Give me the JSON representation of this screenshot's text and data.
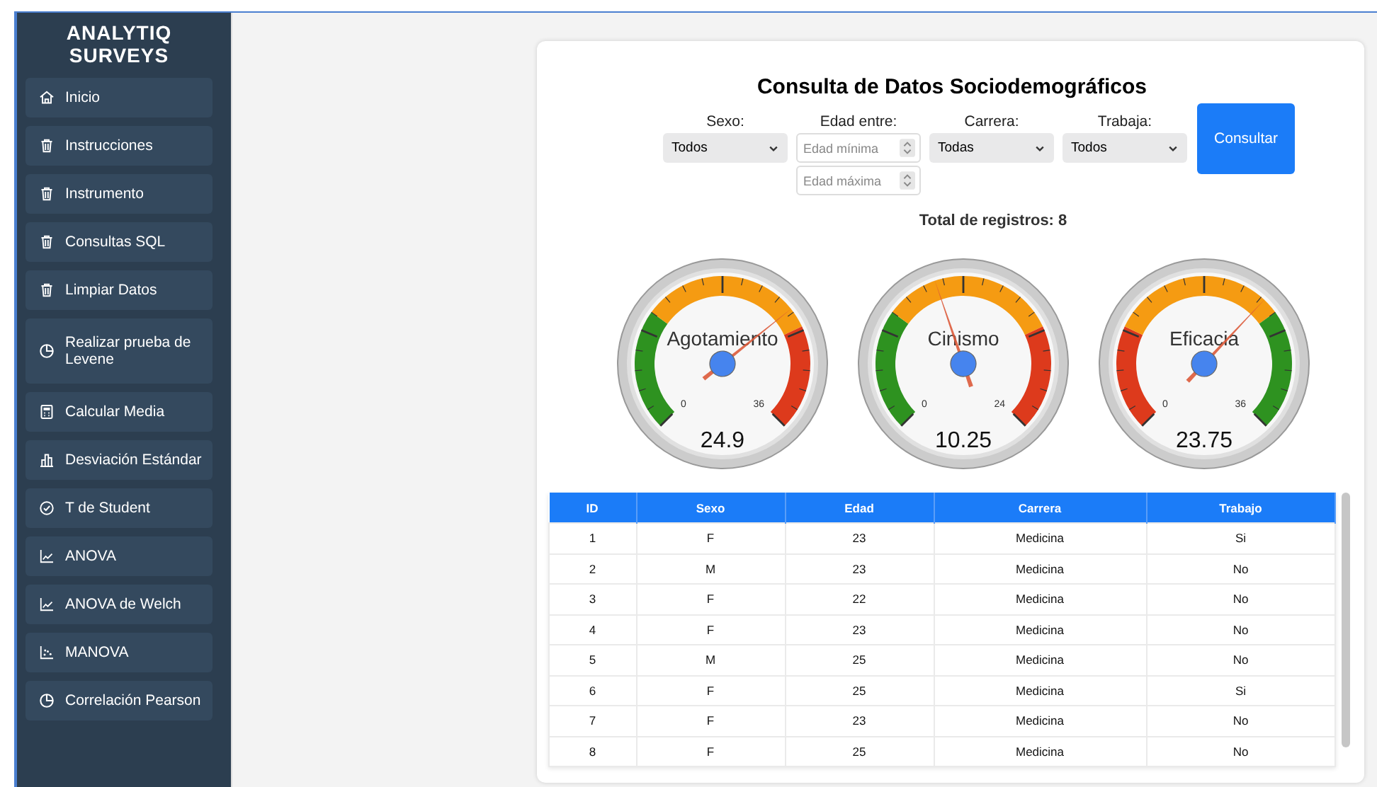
{
  "sidebar": {
    "title": "ANALYTIQ SURVEYS",
    "items": [
      {
        "label": "Inicio",
        "kind": "home"
      },
      {
        "label": "Instrucciones",
        "kind": "trash"
      },
      {
        "label": "Instrumento",
        "kind": "trash"
      },
      {
        "label": "Consultas SQL",
        "kind": "trash"
      },
      {
        "label": "Limpiar Datos",
        "kind": "trash"
      },
      {
        "label": "Realizar prueba de Levene",
        "kind": "clock"
      },
      {
        "label": "Calcular Media",
        "kind": "calculator"
      },
      {
        "label": "Desviación Estándar",
        "kind": "bars"
      },
      {
        "label": "T de Student",
        "kind": "check"
      },
      {
        "label": "ANOVA",
        "kind": "linechart"
      },
      {
        "label": "ANOVA de Welch",
        "kind": "linechart"
      },
      {
        "label": "MANOVA",
        "kind": "scatter"
      },
      {
        "label": "Correlación Pearson",
        "kind": "clock"
      }
    ]
  },
  "query": {
    "title": "Consulta de Datos Sociodemográficos",
    "filters": [
      {
        "label": "Sexo:",
        "kind": "select",
        "value": "Todos"
      },
      {
        "label": "Edad entre:",
        "kind": "range",
        "placeholders": [
          "Edad mínima",
          "Edad máxima"
        ]
      },
      {
        "label": "Carrera:",
        "kind": "select",
        "value": "Todas"
      },
      {
        "label": "Trabaja:",
        "kind": "select",
        "value": "Todos"
      }
    ],
    "button": "Consultar",
    "total": "Total de registros: 8"
  },
  "gauges": [
    {
      "title": "Agotamiento",
      "min": "0",
      "max": "36",
      "value": "24.9",
      "level": 0.69,
      "kind": "low-good"
    },
    {
      "title": "Cinismo",
      "min": "0",
      "max": "24",
      "value": "10.25",
      "level": 0.43,
      "kind": "low-good"
    },
    {
      "title": "Eficacia",
      "min": "0",
      "max": "36",
      "value": "23.75",
      "level": 0.66,
      "kind": "high-good"
    }
  ],
  "table": {
    "columns": [
      "ID",
      "Sexo",
      "Edad",
      "Carrera",
      "Trabajo"
    ],
    "rows": [
      [
        "1",
        "F",
        "23",
        "Medicina",
        "Si"
      ],
      [
        "2",
        "M",
        "23",
        "Medicina",
        "No"
      ],
      [
        "3",
        "F",
        "22",
        "Medicina",
        "No"
      ],
      [
        "4",
        "F",
        "23",
        "Medicina",
        "No"
      ],
      [
        "5",
        "M",
        "25",
        "Medicina",
        "No"
      ],
      [
        "6",
        "F",
        "25",
        "Medicina",
        "Si"
      ],
      [
        "7",
        "F",
        "23",
        "Medicina",
        "No"
      ],
      [
        "8",
        "F",
        "25",
        "Medicina",
        "No"
      ]
    ]
  }
}
